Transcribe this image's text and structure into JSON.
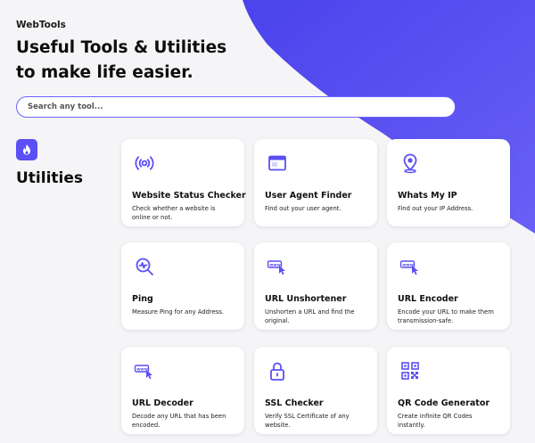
{
  "brand": "WebTools",
  "headline": {
    "line1": "Useful Tools & Utilities",
    "line2": "to make life easier."
  },
  "search": {
    "placeholder": "Search any tool..."
  },
  "category": {
    "title": "Utilities",
    "icon": "flame-icon"
  },
  "colors": {
    "accent": "#5b4ff5",
    "background": "#f5f5f7",
    "card": "#ffffff"
  },
  "tools": [
    {
      "title": "Website Status Checker",
      "desc": "Check whether a website is online or not.",
      "icon": "broadcast-icon"
    },
    {
      "title": "User Agent Finder",
      "desc": "Find out your user agent.",
      "icon": "browser-window-icon"
    },
    {
      "title": "Whats My IP",
      "desc": "Find out your IP Address.",
      "icon": "location-pin-icon"
    },
    {
      "title": "Ping",
      "desc": "Measure Ping for any Address.",
      "icon": "ping-magnifier-icon"
    },
    {
      "title": "URL Unshortener",
      "desc": "Unshorten a URL and find the original.",
      "icon": "url-cursor-icon"
    },
    {
      "title": "URL Encoder",
      "desc": "Encode your URL to make them transmission-safe.",
      "icon": "url-cursor-icon"
    },
    {
      "title": "URL Decoder",
      "desc": "Decode any URL that has been encoded.",
      "icon": "url-cursor-icon"
    },
    {
      "title": "SSL Checker",
      "desc": "Verify SSL Certificate of any website.",
      "icon": "padlock-icon"
    },
    {
      "title": "QR Code Generator",
      "desc": "Create infinite QR Codes instantly.",
      "icon": "qr-code-icon"
    }
  ]
}
